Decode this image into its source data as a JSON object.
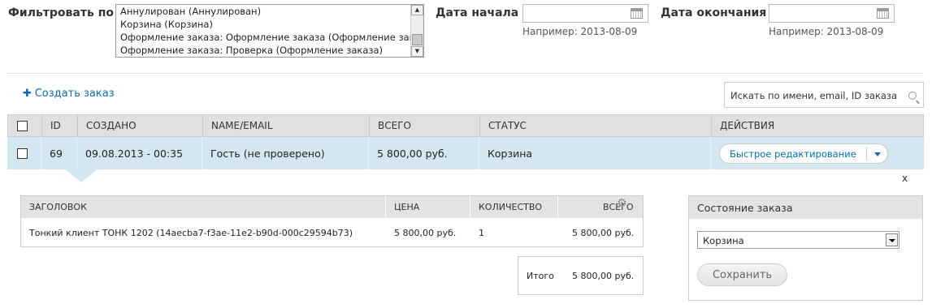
{
  "filter": {
    "label": "Фильтровать по",
    "options": [
      "Аннулирован (Аннулирован)",
      "Корзина (Корзина)",
      "Оформление заказа: Оформление заказа (Оформление заказа)",
      "Оформление заказа: Проверка (Оформление заказа)"
    ]
  },
  "date_start": {
    "label": "Дата начала",
    "value": "",
    "hint": "Например: 2013-08-09"
  },
  "date_end": {
    "label": "Дата окончания",
    "value": "",
    "hint": "Например: 2013-08-09"
  },
  "create_order": {
    "icon": "plus-icon",
    "label": "Создать заказ"
  },
  "search": {
    "placeholder": "Искать по имени, email, ID заказа",
    "icon": "search-icon"
  },
  "table": {
    "headers": [
      "ID",
      "СОЗДАНО",
      "NAME/EMAIL",
      "ВСЕГО",
      "СТАТУС",
      "ДЕЙСТВИЯ"
    ],
    "rows": [
      {
        "id": "69",
        "created": "09.08.2013 - 00:35",
        "name": "Гость (не проверено)",
        "total": "5 800,00 руб.",
        "status": "Корзина",
        "action": "Быстрое редактирование"
      }
    ]
  },
  "details": {
    "close": "x",
    "items_headers": [
      "ЗАГОЛОВОК",
      "ЦЕНА",
      "КОЛИЧЕСТВО",
      "ВСЕГО"
    ],
    "items": [
      {
        "title": "Тонкий клиент ТОНК 1202 (14aecba7-f3ae-11e2-b90d-000c29594b73)",
        "price": "5 800,00 руб.",
        "qty": "1",
        "total": "5 800,00 руб."
      }
    ],
    "total_label": "Итого",
    "total_value": "5 800,00 руб.",
    "state_panel": {
      "title": "Состояние заказа",
      "selected": "Корзина",
      "save": "Сохранить"
    }
  },
  "colors": {
    "link": "#0a6ea8",
    "row_highlight": "#d4e7f1",
    "header_bg": "#e0e0e0"
  }
}
